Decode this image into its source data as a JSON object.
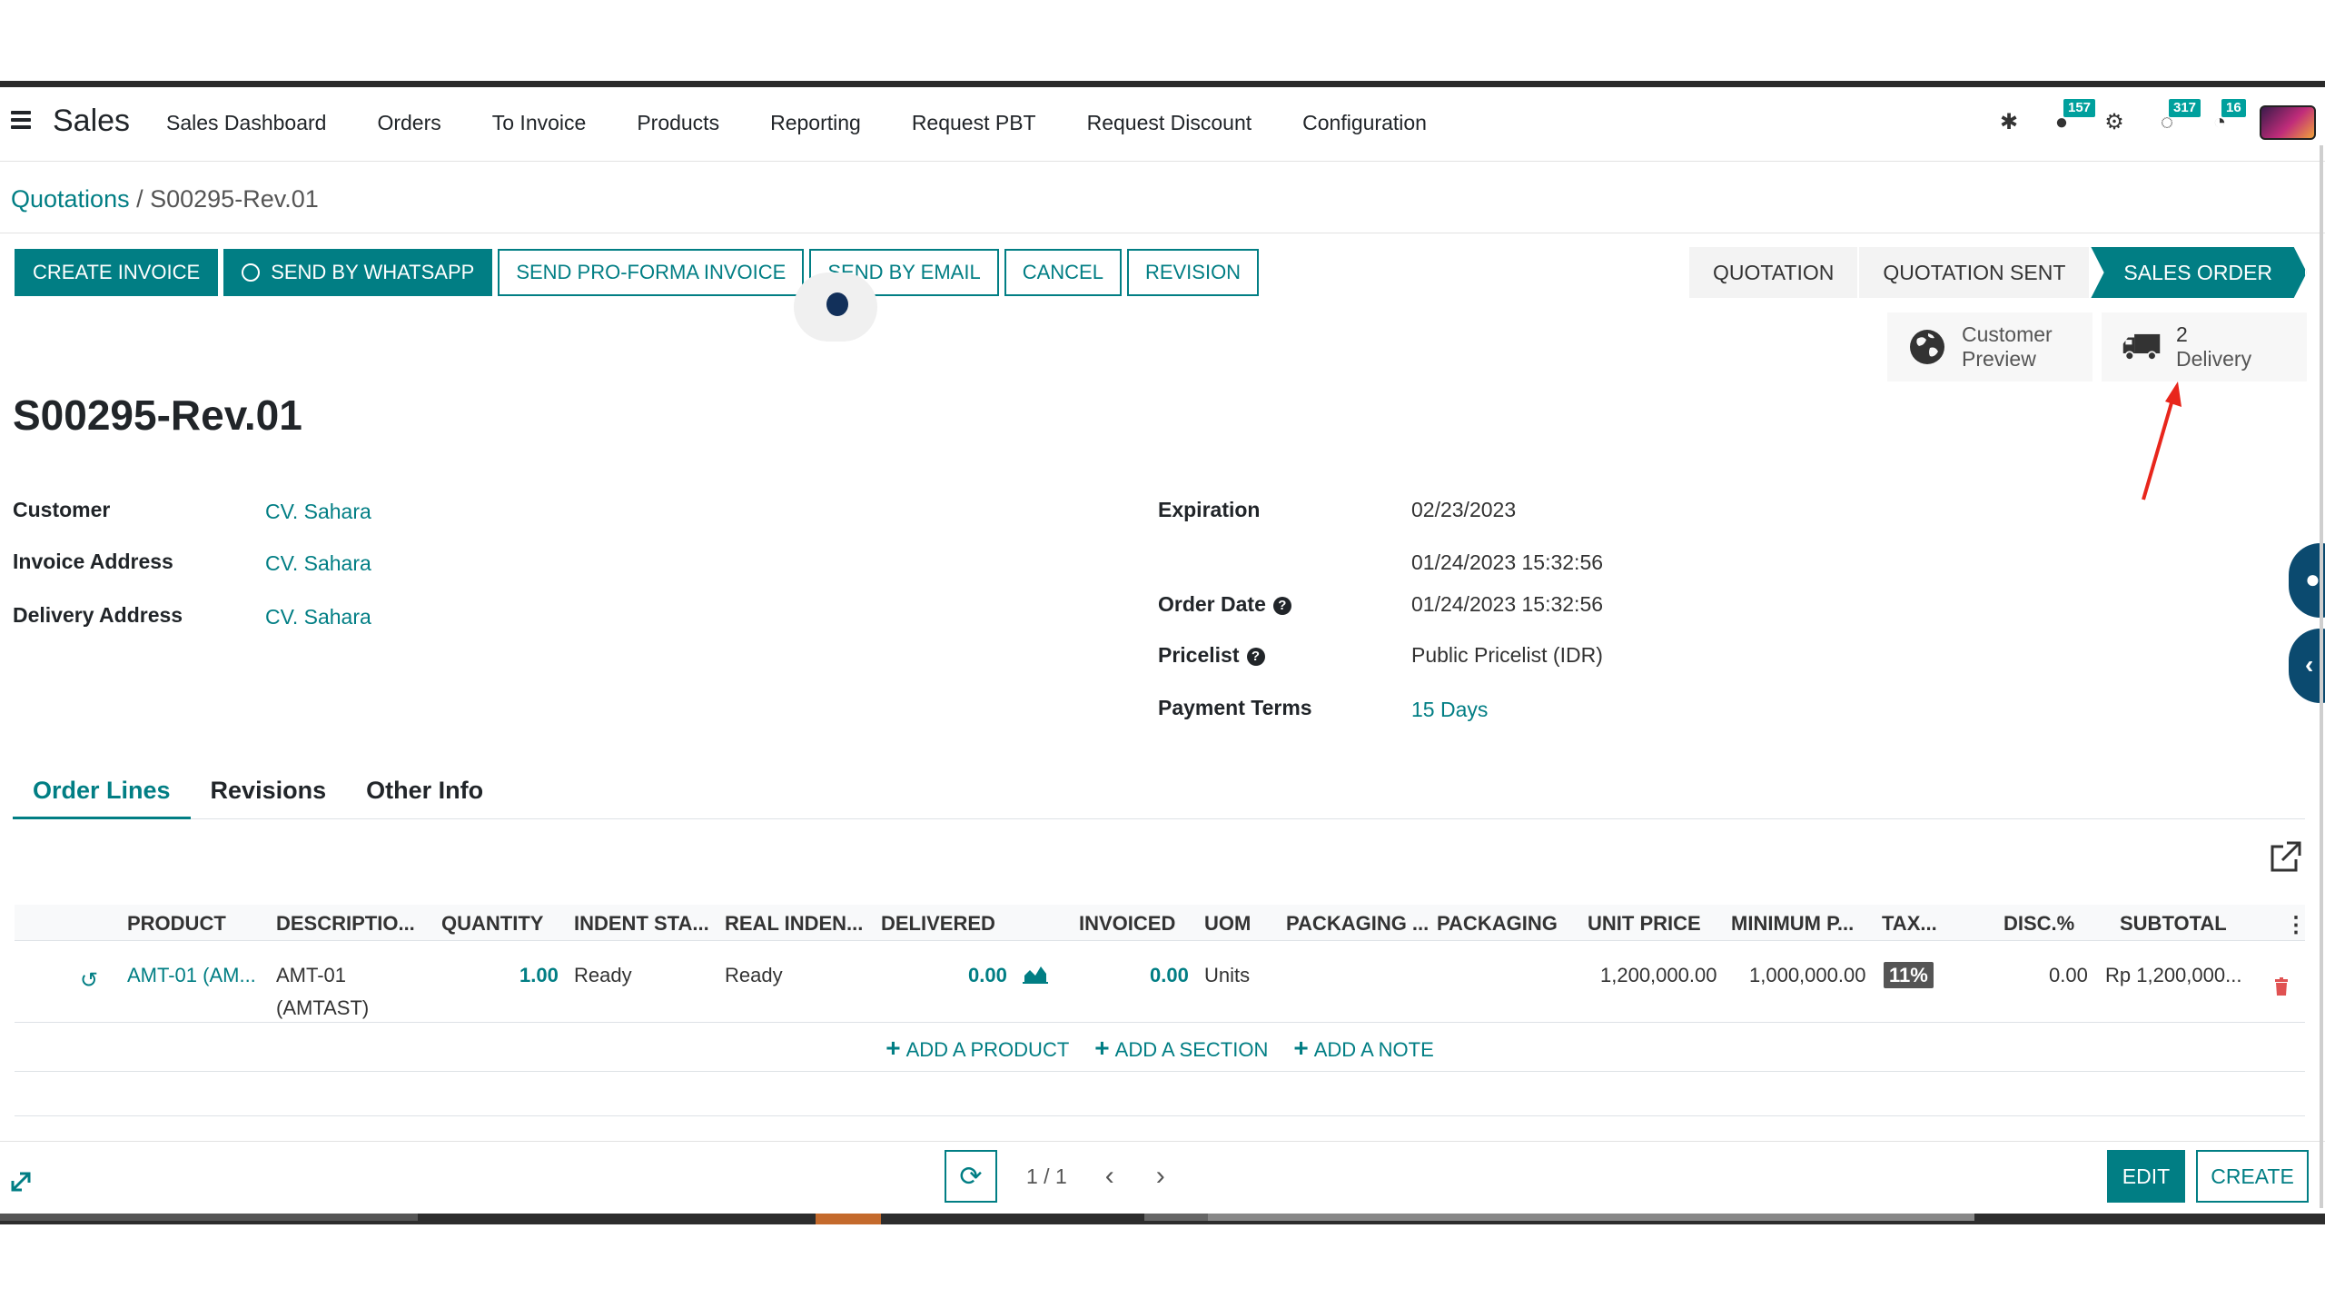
{
  "navbar": {
    "app_name": "Sales",
    "menu": [
      "Sales Dashboard",
      "Orders",
      "To Invoice",
      "Products",
      "Reporting",
      "Request PBT",
      "Request Discount",
      "Configuration"
    ],
    "badges": {
      "messages": "157",
      "activities": "317",
      "clock": "16"
    }
  },
  "breadcrumb": {
    "parent": "Quotations",
    "separator": " / ",
    "current": "S00295-Rev.01"
  },
  "actions": [
    "CREATE INVOICE",
    "SEND BY WHATSAPP",
    "SEND PRO-FORMA INVOICE",
    "SEND BY EMAIL",
    "CANCEL",
    "REVISION"
  ],
  "stages": [
    "QUOTATION",
    "QUOTATION SENT",
    "SALES ORDER"
  ],
  "active_stage": "SALES ORDER",
  "smart_buttons": {
    "preview_line1": "Customer",
    "preview_line2": "Preview",
    "delivery_count": "2",
    "delivery_label": "Delivery"
  },
  "record": {
    "title": "S00295-Rev.01"
  },
  "fields": {
    "customer_label": "Customer",
    "customer_value": "CV. Sahara",
    "invoice_address_label": "Invoice Address",
    "invoice_address_value": "CV. Sahara",
    "delivery_address_label": "Delivery Address",
    "delivery_address_value": "CV. Sahara",
    "expiration_label": "Expiration",
    "expiration_value": "02/23/2023",
    "extra_date_value": "01/24/2023 15:32:56",
    "order_date_label": "Order Date",
    "order_date_value": "01/24/2023 15:32:56",
    "pricelist_label": "Pricelist",
    "pricelist_value": "Public Pricelist (IDR)",
    "payment_terms_label": "Payment Terms",
    "payment_terms_value": "15 Days"
  },
  "tabs": [
    "Order Lines",
    "Revisions",
    "Other Info"
  ],
  "table": {
    "columns": [
      "PRODUCT",
      "DESCRIPTIO...",
      "QUANTITY",
      "INDENT STA...",
      "REAL INDEN...",
      "DELIVERED",
      "INVOICED",
      "UOM",
      "PACKAGING ...",
      "PACKAGING",
      "UNIT PRICE",
      "MINIMUM P...",
      "TAX...",
      "DISC.%",
      "SUBTOTAL"
    ],
    "rows": [
      {
        "product": "AMT-01 (AM...",
        "description_line1": "AMT-01",
        "description_line2": "(AMTAST)",
        "quantity": "1.00",
        "indent_status": "Ready",
        "real_indent": "Ready",
        "delivered": "0.00",
        "invoiced": "0.00",
        "uom": "Units",
        "unit_price": "1,200,000.00",
        "minimum_price": "1,000,000.00",
        "tax": "11%",
        "discount": "0.00",
        "subtotal": "Rp 1,200,000..."
      }
    ],
    "add_links": [
      "ADD A PRODUCT",
      "ADD A SECTION",
      "ADD A NOTE"
    ]
  },
  "footer": {
    "pager": "1 / 1",
    "edit": "EDIT",
    "create": "CREATE"
  },
  "colors": {
    "accent": "#017e84",
    "nav_dark": "#2b2b2b",
    "side_button": "#0b4a6f"
  }
}
